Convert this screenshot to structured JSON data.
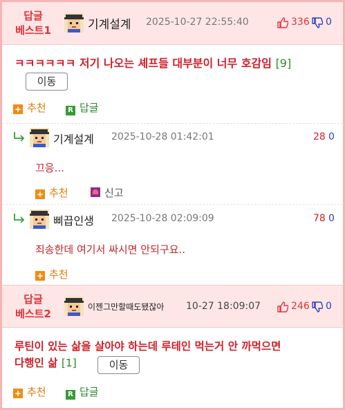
{
  "best1": {
    "label_line1": "답글",
    "label_line2": "베스트1",
    "author": "기계설계",
    "timestamp": "2025-10-27 22:55:40",
    "upvotes": "336",
    "downvotes": "0",
    "text": "ㅋㅋㅋㅋㅋㅋ 저기 나오는 셰프들 대부분이 너무 호감임",
    "comment_count": "[9]",
    "move_label": "이동",
    "recommend_label": "추천",
    "reply_label": "답글"
  },
  "replies": [
    {
      "author": "기계설계",
      "timestamp": "2025-10-28 01:42:01",
      "upvotes": "28",
      "downvotes": "0",
      "text": "끄응...",
      "recommend_label": "추천",
      "report_label": "신고"
    },
    {
      "author": "삐끕인생",
      "timestamp": "2025-10-28 02:09:09",
      "upvotes": "78",
      "downvotes": "0",
      "text": "죄송한데 여기서 싸시면 안되구요..",
      "recommend_label": "추천"
    }
  ],
  "best2": {
    "label_line1": "답글",
    "label_line2": "베스트2",
    "author": "이젠그만할때도됐잖아",
    "timestamp": "10-27 18:09:07",
    "upvotes": "246",
    "downvotes": "0",
    "text_line1": "루틴이 있는 삶을 살아야 하는데 루테인 먹는거 안 까먹으면",
    "text_line2": "다행인 삶",
    "comment_count": "[1]",
    "move_label": "이동",
    "recommend_label": "추천",
    "reply_label": "답글"
  },
  "colors": {
    "accent_red": "#e0323a",
    "header_bg": "#ffe6e6",
    "border_pink": "#f5b5b5",
    "down_blue": "#2a3fbf",
    "green": "#2b8a2b",
    "orange": "#ef8c12"
  },
  "icons": [
    "avatar-icon",
    "thumbs-up-icon",
    "thumbs-down-icon",
    "reply-arrow-icon",
    "plus-icon",
    "r-badge-icon",
    "siren-icon"
  ]
}
